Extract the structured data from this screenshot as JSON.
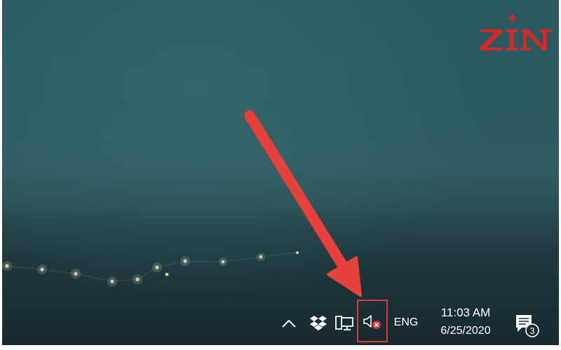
{
  "watermark": {
    "logo_text": "ZIN",
    "color": "#d62828"
  },
  "taskbar": {
    "tray_icons": [
      {
        "name": "show-hidden-icons",
        "icon": "chevron-up-icon"
      },
      {
        "name": "dropbox",
        "icon": "dropbox-icon"
      },
      {
        "name": "network",
        "icon": "network-monitor-icon"
      },
      {
        "name": "volume",
        "icon": "speaker-muted-icon",
        "status": "error"
      }
    ],
    "language": "ENG",
    "clock": {
      "time": "11:03 AM",
      "date": "6/25/2020"
    },
    "notifications": {
      "icon": "action-center-icon",
      "count": "3"
    }
  },
  "annotation": {
    "arrow_color": "#e8403a",
    "highlight_color": "#d63a3a",
    "target": "volume"
  }
}
